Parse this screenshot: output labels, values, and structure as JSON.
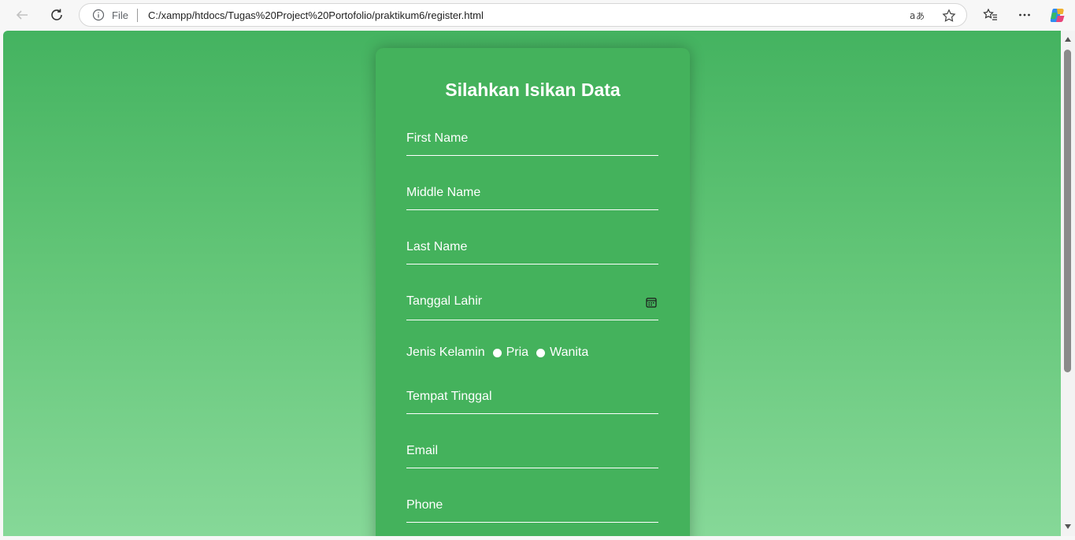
{
  "browser": {
    "file_label": "File",
    "url": "C:/xampp/htdocs/Tugas%20Project%20Portofolio/praktikum6/register.html"
  },
  "form": {
    "title": "Silahkan Isikan Data",
    "fields": {
      "first_name": "First Name",
      "middle_name": "Middle Name",
      "last_name": "Last Name",
      "tanggal_lahir": "Tanggal Lahir",
      "tempat_tinggal": "Tempat Tinggal",
      "email": "Email",
      "phone": "Phone"
    },
    "gender": {
      "label": "Jenis Kelamin",
      "options": [
        "Pria",
        "Wanita"
      ]
    }
  },
  "icons": {
    "back": "back-arrow-icon",
    "reload": "reload-icon",
    "info": "info-icon",
    "read_aloud": "read-aloud-icon",
    "favorite": "star-icon",
    "favorites_list": "favorites-icon",
    "menu": "more-icon",
    "copilot": "copilot-icon",
    "calendar": "calendar-icon"
  },
  "colors": {
    "card": "#44b25c",
    "gradient_top": "#44b360",
    "gradient_bottom": "#86d898"
  }
}
